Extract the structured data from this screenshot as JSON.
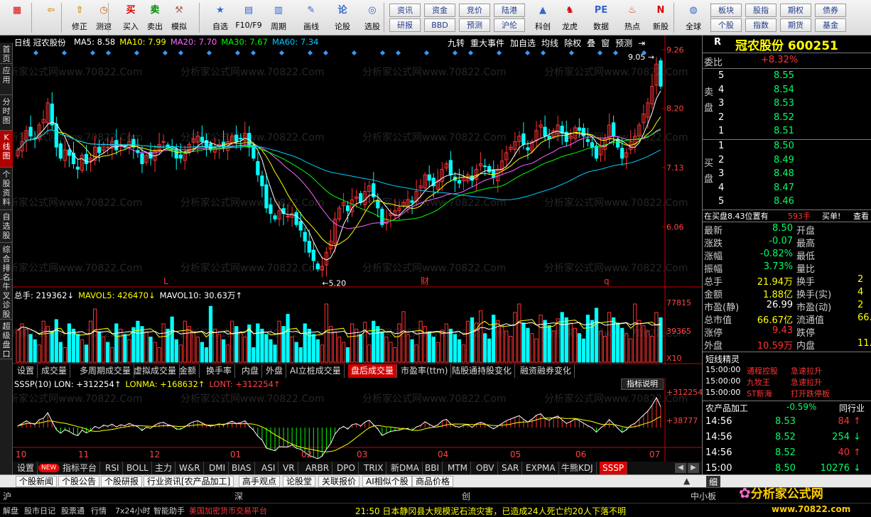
{
  "toolbar": {
    "icons": [
      {
        "label": "",
        "icon": "grid-menu-icon"
      },
      {
        "label": "",
        "icon": "back-arrow-icon"
      },
      {
        "label": "修正",
        "icon": "edit-icon"
      },
      {
        "label": "测速",
        "icon": "clock-icon"
      },
      {
        "label": "买入",
        "icon": "buy-icon",
        "glyph": "买"
      },
      {
        "label": "卖出",
        "icon": "sell-icon",
        "glyph": "卖"
      },
      {
        "label": "模拟",
        "icon": "hammer-icon"
      },
      {
        "label": "自选",
        "icon": "star-icon"
      },
      {
        "label": "F10/F9",
        "icon": "f10-icon"
      },
      {
        "label": "周期",
        "icon": "cycle-icon"
      },
      {
        "label": "画线",
        "icon": "pencil-icon"
      },
      {
        "label": "论股",
        "icon": "discuss-icon"
      },
      {
        "label": "选股",
        "icon": "screener-icon"
      },
      {
        "label": "",
        "icon": "blank-icon"
      },
      {
        "label": "",
        "icon": "blank-icon"
      },
      {
        "label": "",
        "icon": "blank-icon"
      },
      {
        "label": "科创",
        "icon": "kechuang-icon"
      },
      {
        "label": "龙虎",
        "icon": "dragon-tiger-icon"
      },
      {
        "label": "数据",
        "icon": "pe-data-icon"
      },
      {
        "label": "热点",
        "icon": "hot-icon"
      },
      {
        "label": "新股",
        "icon": "ipo-icon"
      },
      {
        "label": "全球",
        "icon": "globe-icon"
      }
    ],
    "buttons_row1": [
      "资讯",
      "资金",
      "竞价",
      "陆港",
      "",
      "",
      "",
      "",
      "",
      "板块",
      "股指",
      "期权",
      "债券"
    ],
    "buttons_row2": [
      "研报",
      "BBD",
      "预测",
      "沪伦",
      "",
      "",
      "",
      "",
      "",
      "个股",
      "指数",
      "期货",
      "基金"
    ]
  },
  "left_tabs": [
    "首页",
    "应用",
    "分时图",
    "K线图",
    "个股资料",
    "自选股",
    "综合排名",
    "牛叉诊股",
    "超级盘口"
  ],
  "chart": {
    "header_name": "日线  冠农股份",
    "ma": [
      {
        "label": "MA5: 8.58",
        "color": "#ffffff"
      },
      {
        "label": "MA10: 7.99",
        "color": "#ffff00"
      },
      {
        "label": "MA20: 7.70",
        "color": "#ff66ff"
      },
      {
        "label": "MA30: 7.67",
        "color": "#00ff00"
      },
      {
        "label": "MA60: 7.34",
        "color": "#00ccff"
      }
    ],
    "top_buttons": [
      "九转",
      "重大事件",
      "加自选",
      "均线",
      "除权",
      "叠",
      "窗",
      "预测",
      "⇥"
    ],
    "price_axis": [
      "9.26",
      "8.20",
      "7.13",
      "6.06"
    ],
    "hi_label": "9.05",
    "lo_label": "5.20",
    "event_marks": [
      "L",
      "财",
      "q"
    ],
    "watermark": "分析家公式网www.70822.Com",
    "vol_header": [
      {
        "label": "总手: 219362↓",
        "color": "#ffffff"
      },
      {
        "label": "MAVOL5: 426470↓",
        "color": "#ffff00"
      },
      {
        "label": "MAVOL10: 30.63万↑",
        "color": "#ffffff"
      }
    ],
    "vol_axis": [
      "77815",
      "39365",
      "X10"
    ],
    "sub_tabs": [
      "设置",
      "成交量",
      "多周期成交量",
      "虚拟成交量",
      "金额",
      "换手率",
      "内盘",
      "外盘",
      "AI立桩成交量",
      "盘后成交量",
      "市盈率(ttm)",
      "陆股通持股变化",
      "融资融券变化"
    ],
    "sub_active": 9,
    "ind_header": [
      {
        "label": "SSSP(10) LON: +312254↑",
        "color": "#ffffff"
      },
      {
        "label": "LONMA: +168632↑",
        "color": "#ffff00"
      },
      {
        "label": "LONT: +312254↑",
        "color": "#ff4444"
      }
    ],
    "ind_explain": "指标说明",
    "ind_axis": [
      "+312254",
      "+38777"
    ],
    "x_months": [
      "10",
      "11",
      "12",
      "01",
      "02",
      "03",
      "04",
      "05",
      "06",
      "07"
    ],
    "indicator_tabs": [
      "设置",
      "NEW",
      "指标平台",
      "RSI",
      "BOLL",
      "主力",
      "W&R",
      "DMI",
      "BIAS",
      "ASI",
      "VR",
      "ARBR",
      "DPO",
      "TRIX",
      "新DMA",
      "BBI",
      "MTM",
      "OBV",
      "SAR",
      "EXPMA",
      "牛熊KDJ",
      "SSSP"
    ],
    "indicator_active": 21
  },
  "chart_data": {
    "type": "candlestick",
    "months": [
      "10",
      "11",
      "12",
      "01",
      "02",
      "03",
      "04",
      "05",
      "06",
      "07"
    ],
    "close": [
      7.45,
      7.6,
      7.8,
      7.7,
      7.65,
      7.9,
      8.0,
      8.3,
      7.9,
      7.5,
      7.3,
      7.45,
      7.35,
      7.2,
      7.1,
      7.35,
      7.2,
      7.3,
      7.5,
      7.4,
      7.55,
      7.5,
      7.6,
      7.45,
      7.55,
      7.5,
      7.6,
      7.5,
      7.4,
      7.2,
      7.35,
      7.3,
      7.45,
      7.55,
      7.6,
      7.5,
      7.45,
      7.3,
      7.3,
      7.4,
      7.55,
      7.65,
      7.7,
      7.6,
      7.5,
      7.45,
      7.5,
      7.55,
      7.5,
      7.6,
      7.7,
      7.6,
      7.65,
      7.75,
      7.5,
      7.3,
      7.0,
      6.8,
      6.4,
      6.3,
      6.2,
      6.35,
      6.3,
      6.25,
      6.3,
      6.1,
      6.0,
      5.8,
      5.6,
      5.45,
      5.3,
      5.35,
      5.6,
      5.8,
      6.2,
      6.4,
      6.5,
      6.35,
      6.55,
      6.6,
      6.5,
      6.7,
      6.8,
      6.6,
      6.4,
      6.1,
      6.2,
      6.3,
      6.35,
      6.4,
      6.5,
      6.55,
      6.5,
      6.7,
      6.8,
      7.0,
      6.9,
      6.8,
      6.9,
      7.1,
      7.2,
      7.0,
      6.9,
      6.85,
      6.95,
      7.0,
      6.9,
      7.1,
      7.2,
      7.15,
      7.05,
      6.95,
      7.1,
      7.25,
      7.4,
      7.5,
      7.6,
      7.7,
      7.55,
      7.45,
      7.6,
      7.8,
      7.9,
      7.7,
      7.65,
      7.8,
      7.9,
      7.75,
      7.6,
      7.7,
      7.85,
      7.8,
      7.7,
      7.6,
      7.5,
      7.3,
      7.5,
      7.65,
      7.9,
      7.7,
      7.5,
      7.3,
      7.4,
      7.6,
      7.7,
      7.9,
      8.1,
      8.3,
      8.6,
      9.0,
      8.6
    ],
    "ma_values": {
      "MA5": 8.58,
      "MA10": 7.99,
      "MA20": 7.7,
      "MA30": 7.67,
      "MA60": 7.34
    },
    "price_axis": [
      9.26,
      8.2,
      7.13,
      6.06
    ],
    "high_label": 9.05,
    "low_label": 5.2,
    "volume_axis": [
      77815,
      39365
    ],
    "indicator_axis": [
      312254,
      38777
    ]
  },
  "panel": {
    "r_label": "R",
    "stock": "冠农股份 600251",
    "weibi_label": "委比",
    "weibi": "+8.32%",
    "sell_label": "卖盘",
    "buy_label": "买盘",
    "asks": [
      {
        "n": "5",
        "p": "8.55"
      },
      {
        "n": "4",
        "p": "8.54"
      },
      {
        "n": "3",
        "p": "8.53"
      },
      {
        "n": "2",
        "p": "8.52"
      },
      {
        "n": "1",
        "p": "8.51"
      }
    ],
    "bids": [
      {
        "n": "1",
        "p": "8.50"
      },
      {
        "n": "2",
        "p": "8.49"
      },
      {
        "n": "3",
        "p": "8.48"
      },
      {
        "n": "4",
        "p": "8.47"
      },
      {
        "n": "5",
        "p": "8.46"
      }
    ],
    "inbuy": "在买盘8.43位置有",
    "inbuy_qty": "593手",
    "inbuy_act": "买单!",
    "inbuy_view": "查看",
    "stats": [
      {
        "k": "最新",
        "v": "8.50",
        "c": "#00ff66",
        "k2": "开盘",
        "v2": ""
      },
      {
        "k": "涨跌",
        "v": "-0.07",
        "c": "#00ff66",
        "k2": "最高",
        "v2": ""
      },
      {
        "k": "涨幅",
        "v": "-0.82%",
        "c": "#00ff66",
        "k2": "最低",
        "v2": ""
      },
      {
        "k": "振幅",
        "v": "3.73%",
        "c": "#00ff66",
        "k2": "量比",
        "v2": ""
      },
      {
        "k": "总手",
        "v": "21.94万",
        "c": "#ffff00",
        "k2": "换手",
        "v2": "2"
      },
      {
        "k": "金额",
        "v": "1.88亿",
        "c": "#ffff00",
        "k2": "换手(实)",
        "v2": "4"
      },
      {
        "k": "市盈(静)",
        "v": "26.99",
        "c": "#ffffff",
        "k2": "市盈(动)",
        "v2": "2"
      },
      {
        "k": "总市值",
        "v": "66.67亿",
        "c": "#ffff00",
        "k2": "流通值",
        "v2": "66."
      },
      {
        "k": "涨停",
        "v": "9.43",
        "c": "#ff3333",
        "k2": "跌停",
        "v2": ""
      },
      {
        "k": "外盘",
        "v": "10.59万",
        "c": "#ff3333",
        "k2": "内盘",
        "v2": "11."
      }
    ],
    "short_title": "短线精灵",
    "shorts": [
      {
        "t": "15:00:00",
        "n": "通程控股",
        "e": "急速拉升",
        "c": "#ff3333"
      },
      {
        "t": "15:00:00",
        "n": "九牧王",
        "e": "急速拉升",
        "c": "#ff3333"
      },
      {
        "t": "15:00:00",
        "n": "ST新海",
        "e": "打开跌停板",
        "c": "#ff3333"
      }
    ],
    "sector": "农产品加工",
    "sector_pct": "-0.59%",
    "sector_cmp": "同行业",
    "ticks": [
      {
        "t": "14:56",
        "p": "8.53",
        "q": "84",
        "d": "up"
      },
      {
        "t": "14:56",
        "p": "8.52",
        "q": "254",
        "d": "down"
      },
      {
        "t": "14:56",
        "p": "8.52",
        "q": "40",
        "d": "up"
      },
      {
        "t": "15:00",
        "p": "8.50",
        "q": "10276",
        "d": "down"
      }
    ]
  },
  "news_tabs": [
    "个股新闻",
    "个股公告",
    "个股研报",
    "行业资讯[农产品加工]",
    "高手观点",
    "论股堂",
    "关联报价",
    "AI相似个股",
    "商品价格"
  ],
  "bottom_left": [
    "细"
  ],
  "status_items": [
    "沪",
    "深",
    "创",
    "中小板"
  ],
  "ticker": "21:50 日本静冈县大规模泥石流灾害，已造成24人死亡约20人下落不明",
  "ticker_left": [
    "解盘",
    "股市日记",
    "股票通",
    "行情",
    "7x24小时",
    "智能助手",
    "美国加密货币交易平台"
  ],
  "logo": "分析家公式网",
  "logo_url": "www.70822.com"
}
